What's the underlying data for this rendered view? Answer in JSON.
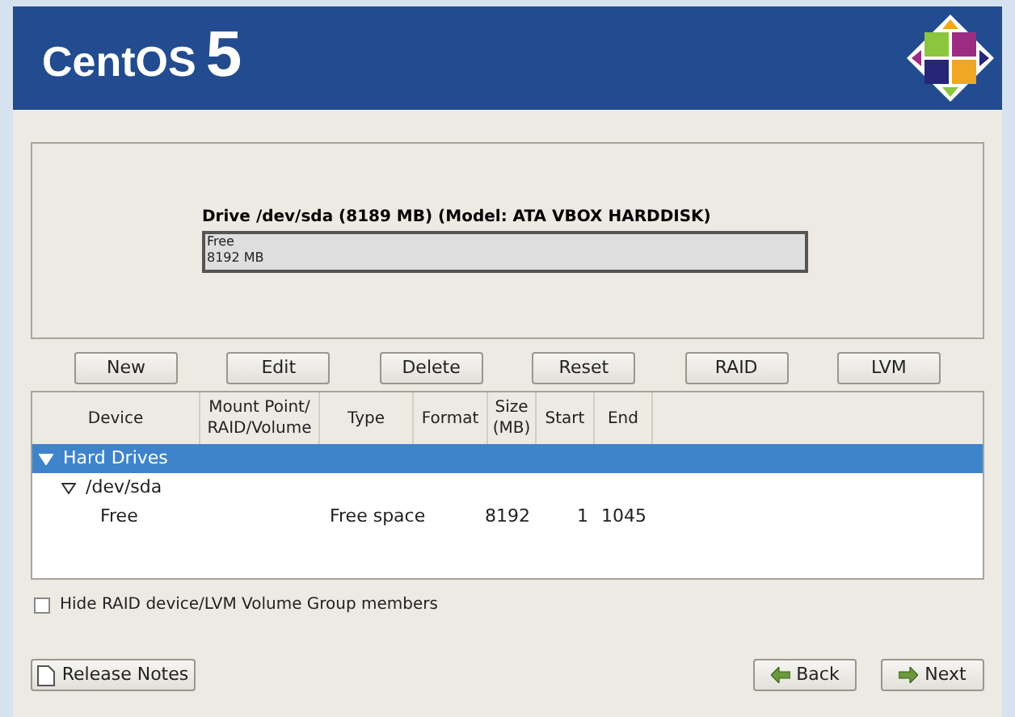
{
  "banner": {
    "brand": "CentOS",
    "version": "5"
  },
  "drive": {
    "title": "Drive /dev/sda (8189 MB) (Model: ATA VBOX HARDDISK)",
    "segment": {
      "label": "Free",
      "size": "8192 MB",
      "selected": true
    }
  },
  "actions": [
    "New",
    "Edit",
    "Delete",
    "Reset",
    "RAID",
    "LVM"
  ],
  "table": {
    "columns": [
      "Device",
      "Mount Point/\nRAID/Volume",
      "Type",
      "Format",
      "Size\n(MB)",
      "Start",
      "End"
    ],
    "rows": [
      {
        "cells": [
          "Hard Drives"
        ],
        "expanded": true,
        "selected": true,
        "children": [
          {
            "cells": [
              "/dev/sda"
            ],
            "expanded": true,
            "selected": false,
            "children": [
              {
                "cells": [
                  "Free",
                  "",
                  "Free space",
                  "",
                  "8192",
                  "1",
                  "1045"
                ],
                "selected": false
              }
            ]
          }
        ]
      }
    ]
  },
  "hide_members": {
    "label": "Hide RAID device/LVM Volume Group members",
    "checked": false
  },
  "footer": {
    "release_notes": "Release Notes",
    "back": "Back",
    "next": "Next"
  }
}
